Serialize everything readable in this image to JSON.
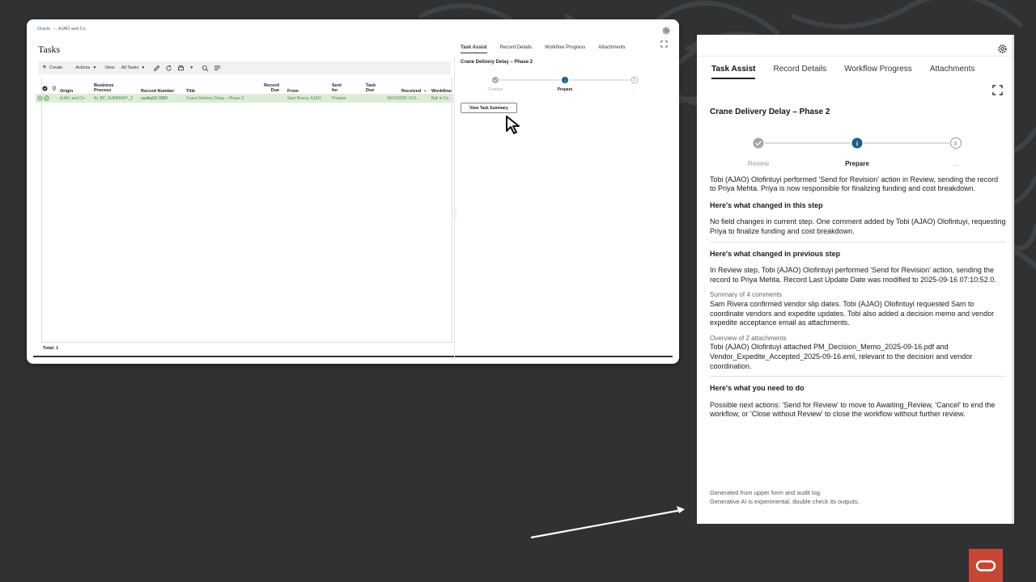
{
  "colors": {
    "background": "#2f3133",
    "row_highlight": "#dcedd7",
    "oracle_red": "#c74634",
    "step_active": "#1f5c8b"
  },
  "left": {
    "breadcrumb": {
      "root": "Oracle",
      "current": "AJAO and Co"
    },
    "page_title": "Tasks",
    "toolbar": {
      "create": "Create",
      "actions": "Actions",
      "view_label": "View:",
      "view_value": "All Tasks"
    },
    "columns": [
      {
        "id": "origin",
        "label": "Origin"
      },
      {
        "id": "process",
        "label": "Business Process"
      },
      {
        "id": "record_number",
        "label": "Record Number"
      },
      {
        "id": "title",
        "label": "Title"
      },
      {
        "id": "record_due",
        "label": "Record Due"
      },
      {
        "id": "from",
        "label": "From"
      },
      {
        "id": "sent_for",
        "label": "Sent for"
      },
      {
        "id": "task_due",
        "label": "Task Due"
      },
      {
        "id": "received",
        "label": "Received"
      },
      {
        "id": "workflow",
        "label": "Workflow"
      }
    ],
    "row": {
      "origin": "AJAO and Co",
      "process": "AI_BP_SUMMARY_2",
      "record_number": "usaibp02-0000",
      "title": "Crane Delivery Delay – Phase 2",
      "from": "Sam Rivera, AJAO",
      "sent_for": "Prepare",
      "received": "09/15/2025 10:5...",
      "workflow": "Ball in Co"
    },
    "total": "Total: 1",
    "mini_panel": {
      "tabs": [
        "Task Assist",
        "Record Details",
        "Workflow Progress",
        "Attachments"
      ],
      "record_title": "Crane Delivery Delay – Phase 2",
      "steps": [
        "Creation",
        "Prepare",
        "..."
      ],
      "step_3_number": "3",
      "button": "View Task Summary"
    }
  },
  "right": {
    "tabs": [
      "Task Assist",
      "Record Details",
      "Workflow Progress",
      "Attachments"
    ],
    "record_title": "Crane Delivery Delay – Phase 2",
    "steps": [
      {
        "label": "Review",
        "state": "done"
      },
      {
        "label": "Prepare",
        "state": "active"
      },
      {
        "label": "...",
        "state": "pending",
        "number": "3"
      }
    ],
    "intro": "Tobi (AJAO) Olofintuyi performed 'Send for Revision' action in Review, sending the record to Priya Mehta. Priya is now responsible for finalizing funding and cost breakdown.",
    "changed_this_step_head": "Here's what changed in this step",
    "changed_this_step": "No field changes in current step. One comment added by Tobi (AJAO) Olofintuyi, requesting Priya to finalize funding and cost breakdown.",
    "changed_prev_step_head": "Here's what changed in previous step",
    "changed_prev_step": "In Review step, Tobi (AJAO) Olofintuyi performed 'Send for Revision' action, sending the record to Priya Mehta. Record Last Update Date was modified to 2025-09-16 07:10:52.0.",
    "comments_head": "Summary of 4 comments",
    "comments": "Sam Rivera confirmed vendor slip dates. Tobi (AJAO) Olofintuyi requested Sam to coordinate vendors and expedite updates. Tobi also added a decision memo and vendor expedite acceptance email as attachments.",
    "attachments_head": "Overview of 2 attachments",
    "attachments": "Tobi (AJAO) Olofintuyi attached PM_Decision_Memo_2025-09-16.pdf and Vendor_Expedite_Accepted_2025-09-16.eml, relevant to the decision and vendor coordination.",
    "todo_head": "Here's what you need to do",
    "todo": "Possible next actions: 'Send for Review' to move to Awaiting_Review, 'Cancel' to end the workflow, or 'Close without Review' to close the workflow without further review.",
    "footnote_1": "Generated from upper form and audit log.",
    "footnote_2": "Generative AI is experimental, double check its outputs."
  }
}
